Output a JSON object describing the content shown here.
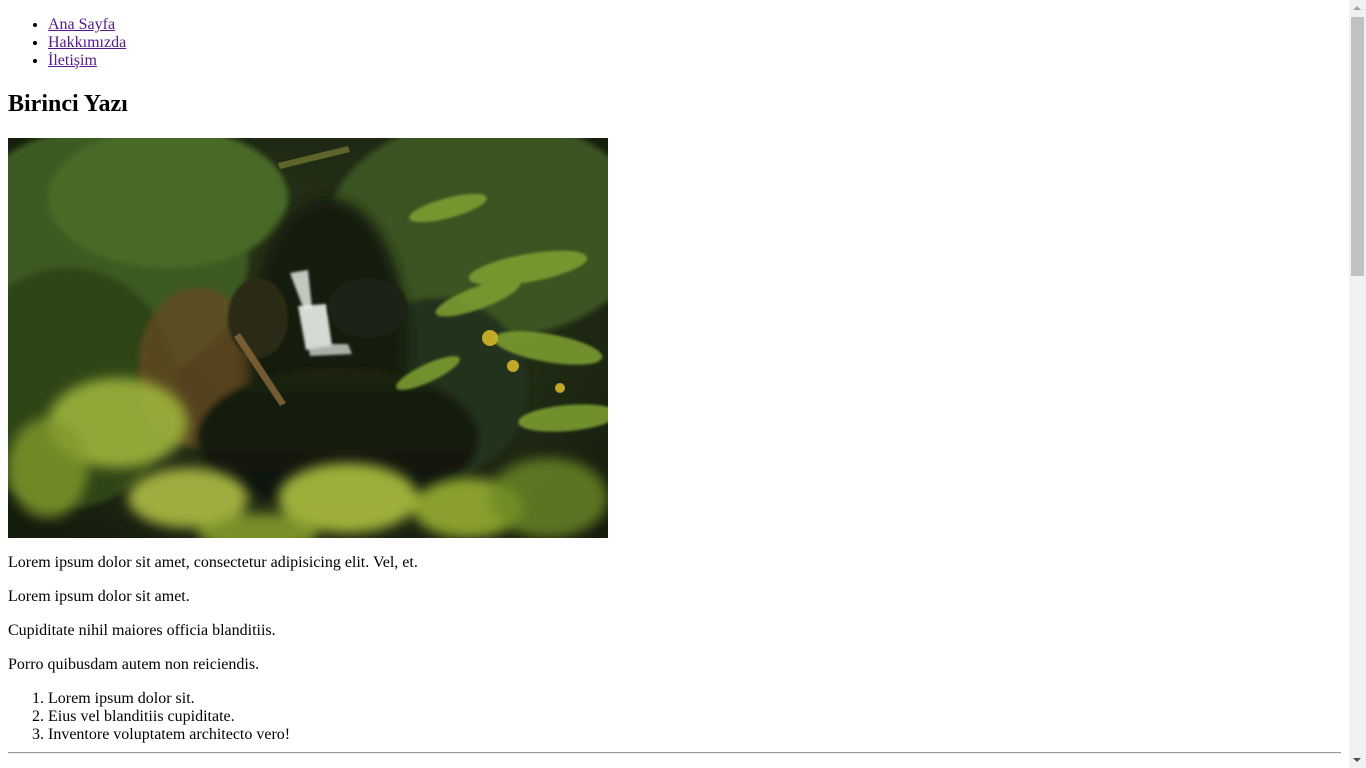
{
  "nav": {
    "items": [
      {
        "label": "Ana Sayfa"
      },
      {
        "label": "Hakkımızda"
      },
      {
        "label": "İletişim"
      }
    ]
  },
  "post": {
    "title": "Birinci Yazı",
    "paragraphs": [
      "Lorem ipsum dolor sit amet, consectetur adipisicing elit. Vel, et.",
      "Lorem ipsum dolor sit amet.",
      "Cupiditate nihil maiores officia blanditiis.",
      "Porro quibusdam autem non reiciendis."
    ],
    "list": [
      "Lorem ipsum dolor sit.",
      "Eius vel blanditiis cupiditate.",
      "Inventore voluptatem architecto vero!"
    ]
  },
  "colors": {
    "visited_link": "#551a8b",
    "scrollbar_track": "#f1f1f1",
    "scrollbar_thumb": "#c1c1c1"
  },
  "icons": {
    "scroll_up": "scroll-up-arrow-icon",
    "scroll_down": "scroll-down-arrow-icon"
  }
}
